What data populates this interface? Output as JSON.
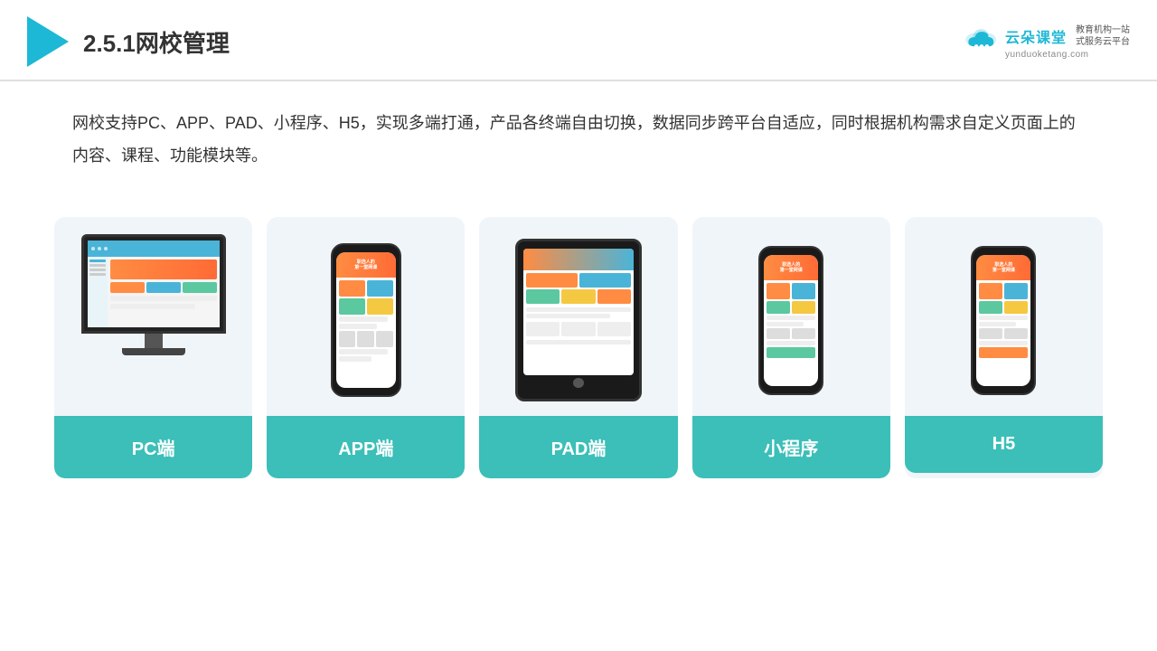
{
  "header": {
    "title": "2.5.1网校管理",
    "brand": {
      "name": "云朵课堂",
      "url": "yunduoketang.com",
      "slogan_line1": "教育机构一站",
      "slogan_line2": "式服务云平台"
    }
  },
  "description": {
    "text": "网校支持PC、APP、PAD、小程序、H5，实现多端打通，产品各终端自由切换，数据同步跨平台自适应，同时根据机构需求自定义页面上的内容、课程、功能模块等。"
  },
  "cards": [
    {
      "id": "pc",
      "label": "PC端"
    },
    {
      "id": "app",
      "label": "APP端"
    },
    {
      "id": "pad",
      "label": "PAD端"
    },
    {
      "id": "miniprogram",
      "label": "小程序"
    },
    {
      "id": "h5",
      "label": "H5"
    }
  ]
}
